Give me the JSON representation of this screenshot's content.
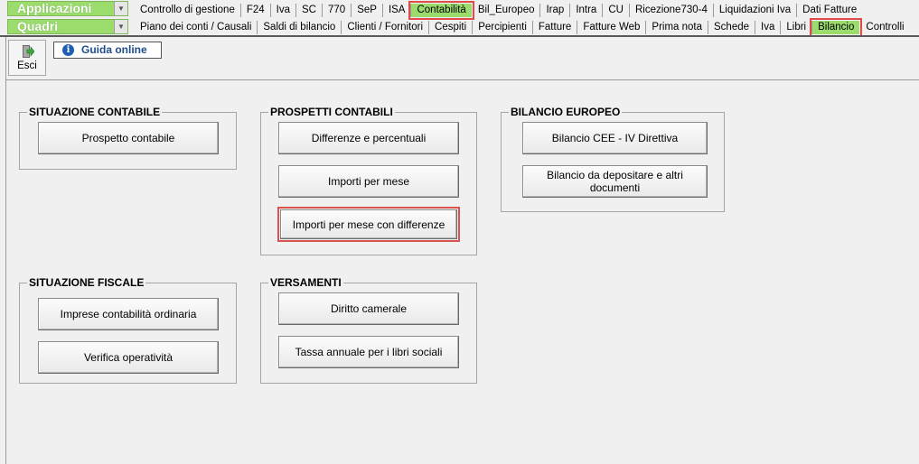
{
  "menus": {
    "applicazioni": {
      "label": "Applicazioni"
    },
    "quadri": {
      "label": "Quadri"
    }
  },
  "app_tabs": [
    "Controllo di gestione",
    "F24",
    "Iva",
    "SC",
    "770",
    "SeP",
    "ISA",
    "Contabilità",
    "Bil_Europeo",
    "Irap",
    "Intra",
    "CU",
    "Ricezione730-4",
    "Liquidazioni Iva",
    "Dati Fatture"
  ],
  "quadri_tabs": [
    "Piano dei conti / Causali",
    "Saldi di bilancio",
    "Clienti / Fornitori",
    "Cespiti",
    "Percipienti",
    "Fatture",
    "Fatture Web",
    "Prima nota",
    "Schede",
    "Iva",
    "Libri",
    "Bilancio",
    "Controlli"
  ],
  "toolbar": {
    "esci_label": "Esci",
    "guida_label": "Guida online"
  },
  "groups": {
    "situazione_contabile": {
      "title": "SITUAZIONE CONTABILE",
      "buttons": [
        "Prospetto contabile"
      ]
    },
    "prospetti_contabili": {
      "title": "PROSPETTI CONTABILI",
      "buttons": [
        "Differenze e percentuali",
        "Importi per mese",
        "Importi per mese con differenze"
      ]
    },
    "bilancio_europeo": {
      "title": "BILANCIO EUROPEO",
      "buttons": [
        "Bilancio CEE - IV Direttiva",
        "Bilancio da depositare e altri documenti"
      ]
    },
    "situazione_fiscale": {
      "title": "SITUAZIONE FISCALE",
      "buttons": [
        "Imprese contabilità ordinaria",
        "Verifica operatività"
      ]
    },
    "versamenti": {
      "title": "VERSAMENTI",
      "buttons": [
        "Diritto camerale",
        "Tassa annuale per i libri sociali"
      ]
    }
  },
  "colors": {
    "accent_green": "#9bdc6c",
    "highlight_red": "#e04a4a",
    "info_blue": "#1e5fb4"
  },
  "icons": {
    "esci": "exit-door-icon",
    "guida": "info-icon",
    "dropdown": "chevron-down-icon"
  }
}
